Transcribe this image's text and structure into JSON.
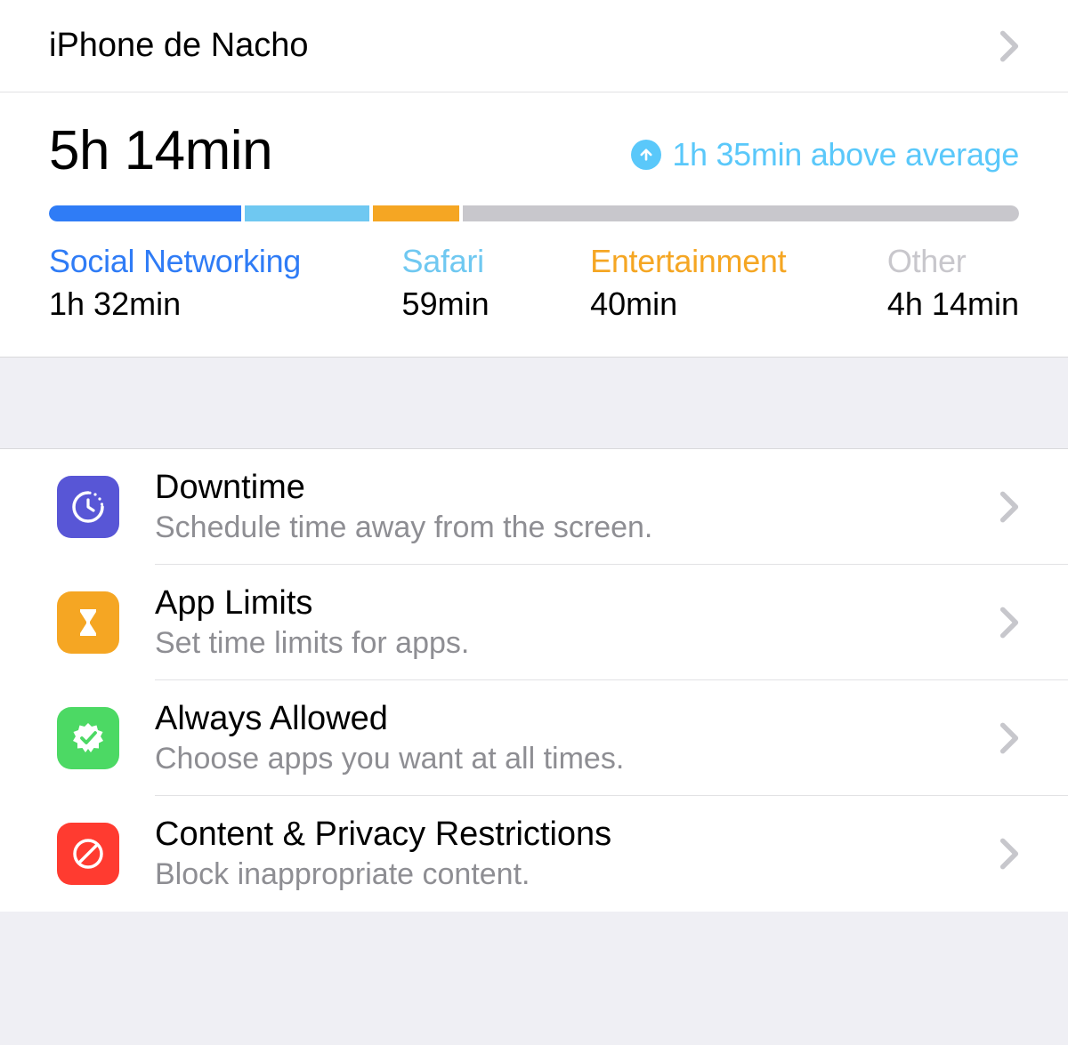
{
  "device": {
    "name": "iPhone de Nacho"
  },
  "summary": {
    "total_time": "5h 14min",
    "comparison_text": "1h 35min above average"
  },
  "categories": [
    {
      "label": "Social Networking",
      "time": "1h 32min",
      "color": "#2f7cf6"
    },
    {
      "label": "Safari",
      "time": "59min",
      "color": "#6fc8f1"
    },
    {
      "label": "Entertainment",
      "time": "40min",
      "color": "#f5a623"
    },
    {
      "label": "Other",
      "time": "4h 14min",
      "color": "#c8c7cc"
    }
  ],
  "bar": {
    "segments": [
      {
        "color": "#2f7cf6",
        "pct": 20
      },
      {
        "color": "#6fc8f1",
        "pct": 13
      },
      {
        "color": "#f5a623",
        "pct": 9
      },
      {
        "color": "#c8c7cc",
        "pct": 58
      }
    ]
  },
  "settings": [
    {
      "icon": "downtime-icon",
      "icon_bg": "#5856d6",
      "title": "Downtime",
      "subtitle": "Schedule time away from the screen."
    },
    {
      "icon": "app-limits-icon",
      "icon_bg": "#f5a623",
      "title": "App Limits",
      "subtitle": "Set time limits for apps."
    },
    {
      "icon": "always-allowed-icon",
      "icon_bg": "#4cd964",
      "title": "Always Allowed",
      "subtitle": "Choose apps you want at all times."
    },
    {
      "icon": "restrictions-icon",
      "icon_bg": "#ff3b30",
      "title": "Content & Privacy Restrictions",
      "subtitle": "Block inappropriate content."
    }
  ],
  "chart_data": {
    "type": "bar",
    "title": "Screen Time usage",
    "categories": [
      "Social Networking",
      "Safari",
      "Entertainment",
      "Other"
    ],
    "values_minutes": [
      92,
      59,
      40,
      254
    ],
    "total_minutes": 314,
    "comparison_minutes_above_average": 95
  }
}
